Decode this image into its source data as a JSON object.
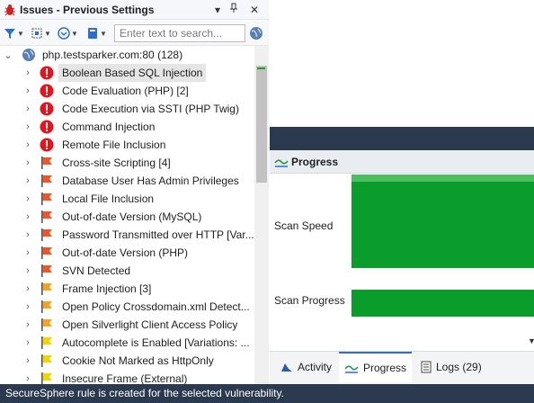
{
  "window": {
    "panel_title": "Issues - Previous Settings",
    "pin_glyph": "📌",
    "menu_glyph": "▾",
    "close_glyph": "✕"
  },
  "toolbar": {
    "search": {
      "placeholder": "Enter text to search...",
      "value": ""
    },
    "buttons": [
      "filter-icon",
      "select-icon",
      "options-icon",
      "view-icon",
      "globe-icon"
    ]
  },
  "tree": {
    "root": {
      "label": "php.testsparker.com:80 (128)",
      "icon": "globe-icon",
      "expanded": true
    },
    "items": [
      {
        "label": "Boolean Based SQL Injection",
        "severity": "critical",
        "selected": true
      },
      {
        "label": "Code Evaluation (PHP) [2]",
        "severity": "critical"
      },
      {
        "label": "Code Execution via SSTI (PHP Twig)",
        "severity": "critical"
      },
      {
        "label": "Command Injection",
        "severity": "critical"
      },
      {
        "label": "Remote File Inclusion",
        "severity": "critical"
      },
      {
        "label": "Cross-site Scripting [4]",
        "severity": "high"
      },
      {
        "label": "Database User Has Admin Privileges",
        "severity": "high"
      },
      {
        "label": "Local File Inclusion",
        "severity": "high"
      },
      {
        "label": "Out-of-date Version (MySQL)",
        "severity": "high"
      },
      {
        "label": "Password Transmitted over HTTP [Var...",
        "severity": "high"
      },
      {
        "label": "Out-of-date Version (PHP)",
        "severity": "high"
      },
      {
        "label": "SVN Detected",
        "severity": "high"
      },
      {
        "label": "Frame Injection [3]",
        "severity": "medium"
      },
      {
        "label": "Open Policy Crossdomain.xml Detect...",
        "severity": "medium"
      },
      {
        "label": "Open Silverlight Client Access Policy",
        "severity": "medium"
      },
      {
        "label": "Autocomplete is Enabled [Variations: ...",
        "severity": "low"
      },
      {
        "label": "Cookie Not Marked as HttpOnly",
        "severity": "low"
      },
      {
        "label": "Insecure Frame (External)",
        "severity": "low"
      }
    ]
  },
  "severity_colors": {
    "critical": "#e8111c",
    "high": "#f0552a",
    "medium": "#f5a21e",
    "low": "#f3d400"
  },
  "progress": {
    "title": "Progress",
    "scan_speed_label": "Scan Speed",
    "scan_progress_label": "Scan Progress",
    "bar_color": "#0a9d2c"
  },
  "tabs": [
    {
      "label": "Activity",
      "icon": "activity-icon"
    },
    {
      "label": "Progress",
      "icon": "progress-icon",
      "active": true
    },
    {
      "label": "Logs (29)",
      "icon": "logs-icon"
    }
  ],
  "status": {
    "text": "SecureSphere rule is created for the selected vulnerability."
  },
  "colors": {
    "dark": "#2b3a4f",
    "accent": "#2b6ecf"
  }
}
